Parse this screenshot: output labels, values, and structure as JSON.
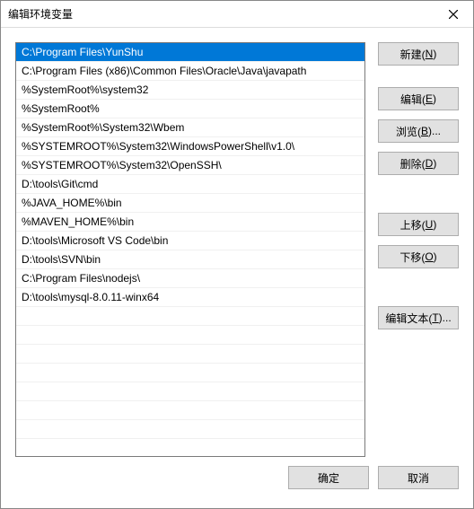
{
  "window": {
    "title": "编辑环境变量"
  },
  "list": {
    "items": [
      "C:\\Program Files\\YunShu",
      "C:\\Program Files (x86)\\Common Files\\Oracle\\Java\\javapath",
      "%SystemRoot%\\system32",
      "%SystemRoot%",
      "%SystemRoot%\\System32\\Wbem",
      "%SYSTEMROOT%\\System32\\WindowsPowerShell\\v1.0\\",
      "%SYSTEMROOT%\\System32\\OpenSSH\\",
      "D:\\tools\\Git\\cmd",
      "%JAVA_HOME%\\bin",
      "%MAVEN_HOME%\\bin",
      "D:\\tools\\Microsoft VS Code\\bin",
      "D:\\tools\\SVN\\bin",
      "C:\\Program Files\\nodejs\\",
      "D:\\tools\\mysql-8.0.11-winx64"
    ],
    "selected_index": 0
  },
  "buttons": {
    "new": {
      "text": "新建(",
      "accel": "N",
      "tail": ")"
    },
    "edit": {
      "text": "编辑(",
      "accel": "E",
      "tail": ")"
    },
    "browse": {
      "text": "浏览(",
      "accel": "B",
      "tail": ")..."
    },
    "delete": {
      "text": "删除(",
      "accel": "D",
      "tail": ")"
    },
    "moveup": {
      "text": "上移(",
      "accel": "U",
      "tail": ")"
    },
    "movedown": {
      "text": "下移(",
      "accel": "O",
      "tail": ")"
    },
    "edittext": {
      "text": "编辑文本(",
      "accel": "T",
      "tail": ")..."
    },
    "ok": {
      "label": "确定"
    },
    "cancel": {
      "label": "取消"
    }
  }
}
